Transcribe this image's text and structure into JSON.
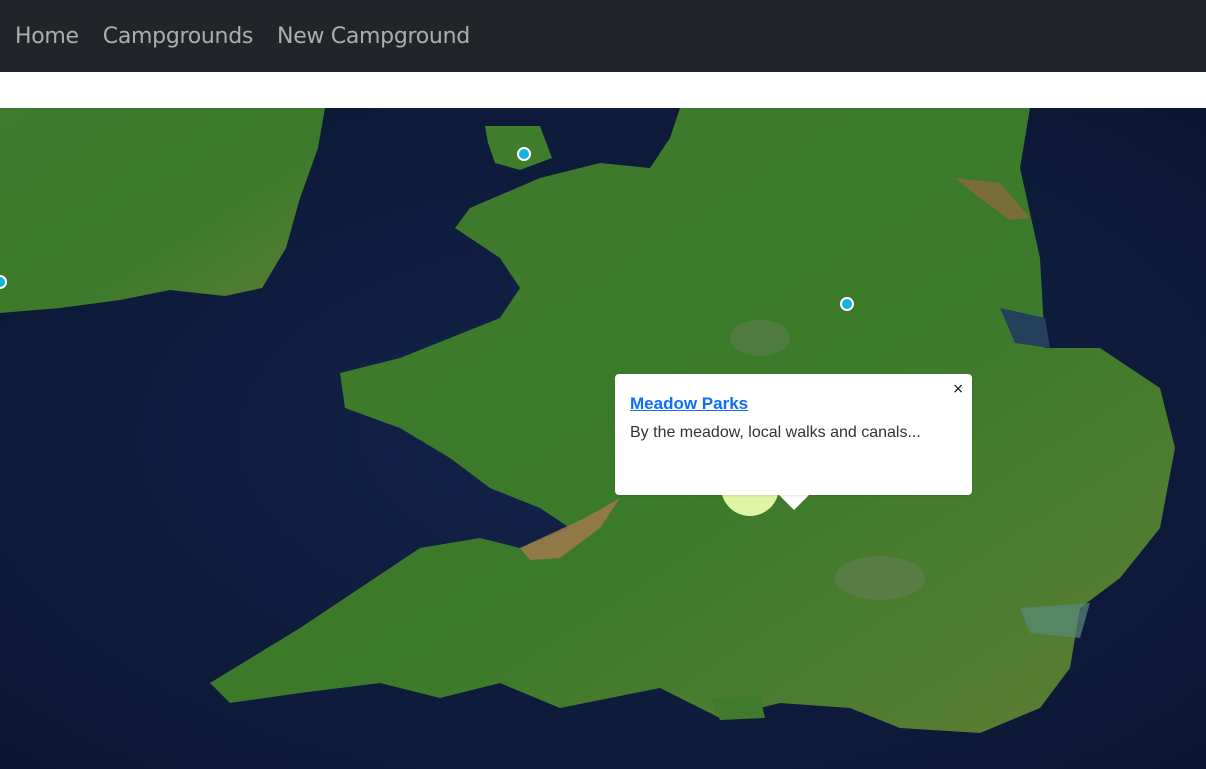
{
  "navbar": {
    "links": [
      {
        "label": "Home"
      },
      {
        "label": "Campgrounds"
      },
      {
        "label": "New Campground"
      }
    ]
  },
  "map": {
    "style": "satellite",
    "marker_color": "#11b4da",
    "cluster_color": "#e0f5a3",
    "popup": {
      "title": "Meadow Parks",
      "description": "By the meadow, local walks and canals...",
      "close_glyph": "×"
    }
  }
}
